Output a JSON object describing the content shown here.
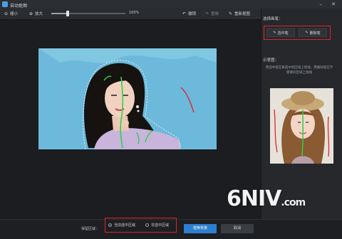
{
  "window": {
    "title": "自动抠图",
    "minimize_glyph": "–",
    "close_glyph": "✕"
  },
  "toolbar": {
    "shrink": {
      "label": "缩小",
      "icon": "zoom-out-icon"
    },
    "enlarge": {
      "label": "放大",
      "icon": "zoom-in-icon"
    },
    "zoom_value": "100%",
    "zoom_fraction": 0.22,
    "undo": {
      "label": "撤销",
      "icon": "undo-icon"
    },
    "redo": {
      "label": "重做",
      "icon": "redo-icon"
    },
    "restart": {
      "label": "重新抠图",
      "icon": "restart-icon"
    }
  },
  "sidebar": {
    "brush_title": "选择画笔：",
    "select_brush": {
      "label": "选中笔",
      "icon": "pen-icon"
    },
    "deselect_brush": {
      "label": "删除笔",
      "icon": "pen-icon"
    },
    "sample_title": "示意图：",
    "tip": "用选中笔在要选中的区域上划线，用删除笔在不需要的区域上划线"
  },
  "bottom": {
    "area_label": "保留区域：",
    "radio_selected": "当前选中区域",
    "radio_unselected": "非选中区域",
    "primary_button": "替换背景",
    "secondary_button": "取消"
  },
  "watermark": {
    "main": "6NIV",
    "suffix": ".com"
  },
  "colors": {
    "highlight_border": "#e0242b",
    "primary_button": "#2f7fd0",
    "select_stroke": "#2fd14a",
    "remove_stroke": "#e0242b",
    "canvas_bg": "#1b1d20",
    "photo_bg": "#6cb9db"
  }
}
